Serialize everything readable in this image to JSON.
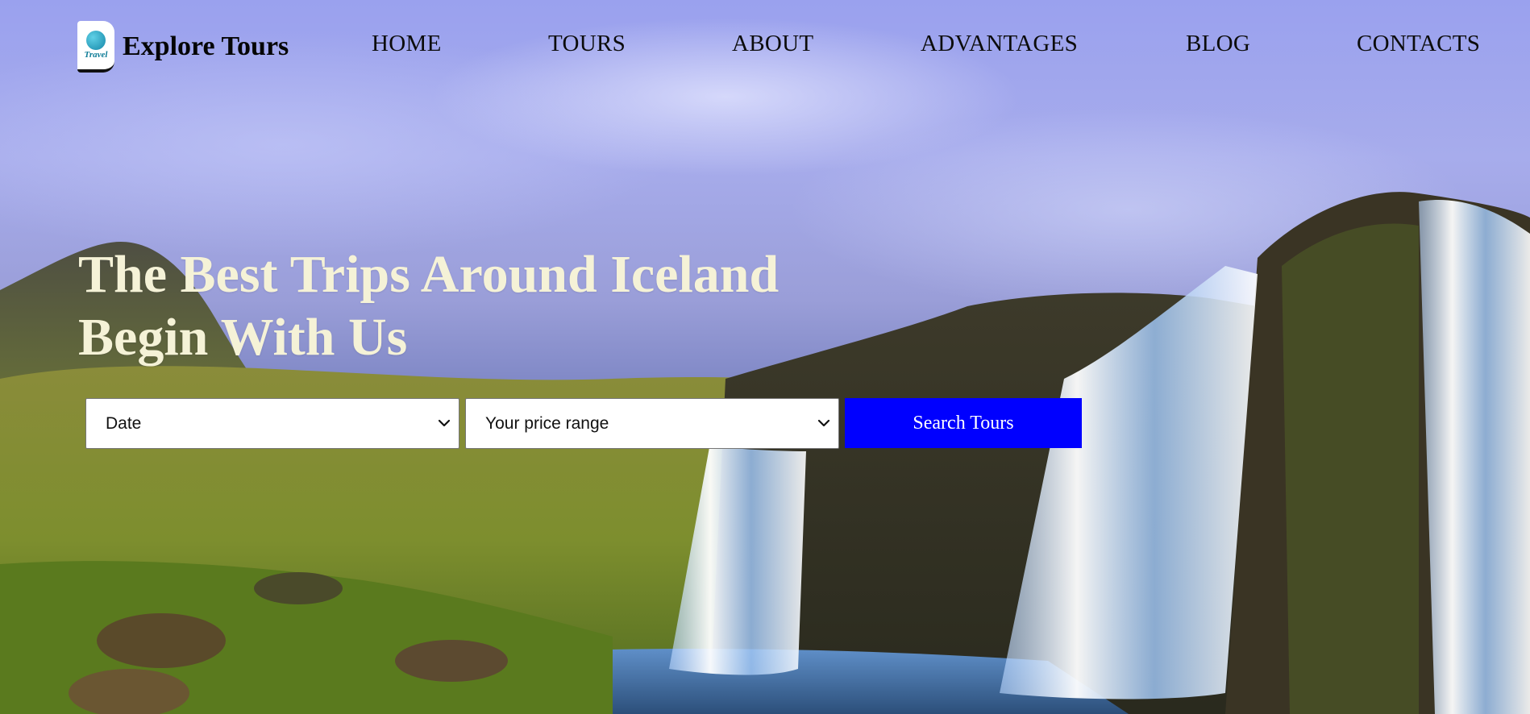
{
  "brand": {
    "logo_text": "Travel",
    "name": "Explore Tours"
  },
  "nav": {
    "items": [
      "HOME",
      "TOURS",
      "ABOUT",
      "ADVANTAGES",
      "BLOG",
      "CONTACTS"
    ]
  },
  "hero": {
    "title_line1": "The Best Trips Around Iceland",
    "title_line2": "Begin With Us"
  },
  "search": {
    "date_selected": "Date",
    "price_selected": "Your price range",
    "button_label": "Search Tours"
  },
  "colors": {
    "accent_button": "#0000ff",
    "heading": "#f5f2d7",
    "nav_text": "#0c0c0c"
  }
}
